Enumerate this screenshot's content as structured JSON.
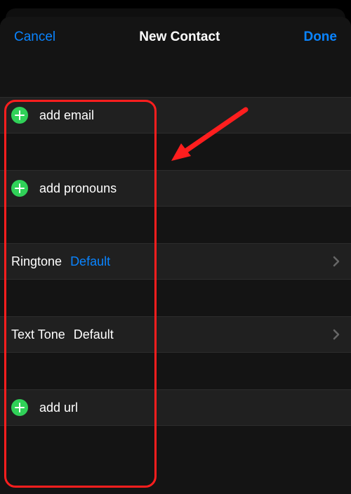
{
  "header": {
    "cancel": "Cancel",
    "title": "New Contact",
    "done": "Done"
  },
  "rows": {
    "addEmail": "add email",
    "addPronouns": "add pronouns",
    "ringtoneLabel": "Ringtone",
    "ringtoneValue": "Default",
    "textToneLabel": "Text Tone",
    "textToneValue": "Default",
    "addUrl": "add url"
  }
}
